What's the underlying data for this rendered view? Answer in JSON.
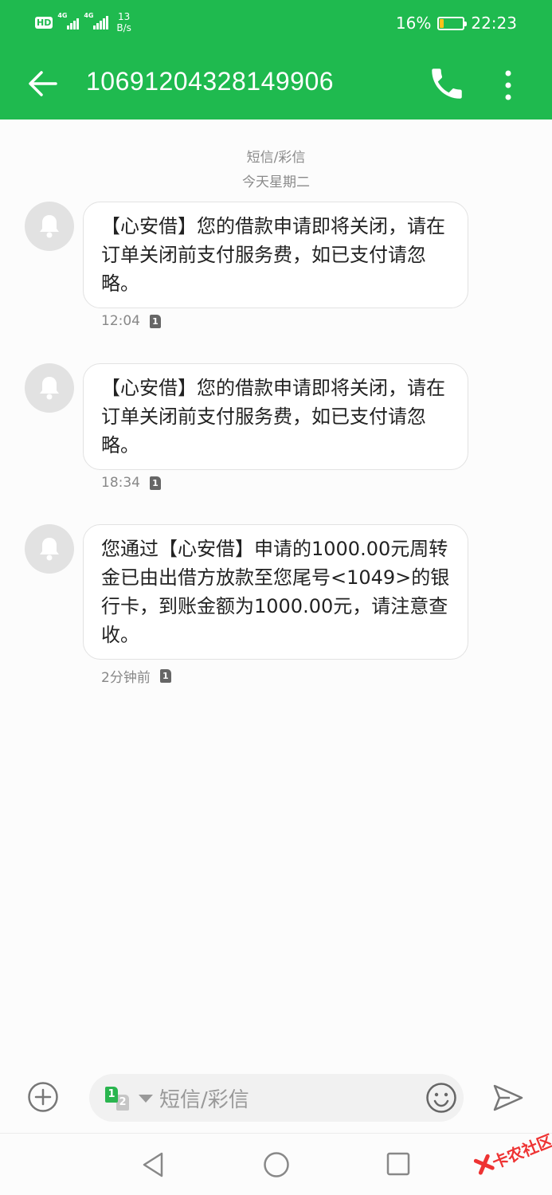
{
  "status_bar": {
    "hd_badge": "HD",
    "signal_1_label": "4G",
    "signal_2_label": "4G",
    "net_speed_value": "13",
    "net_speed_unit": "B/s",
    "battery_percent_text": "16%",
    "battery_level": 0.16,
    "time": "22:23"
  },
  "app_bar": {
    "title": "10691204328149906",
    "icons": [
      "back-arrow-icon",
      "phone-icon",
      "more-vert-icon"
    ]
  },
  "conversation": {
    "type_label": "短信/彩信",
    "date_label": "今天星期二",
    "messages": [
      {
        "text": "【心安借】您的借款申请即将关闭，请在订单关闭前支付服务费，如已支付请忽略。",
        "time": "12:04",
        "sim": "1"
      },
      {
        "text": "【心安借】您的借款申请即将关闭，请在订单关闭前支付服务费，如已支付请忽略。",
        "time": "18:34",
        "sim": "1"
      },
      {
        "text": "您通过【心安借】申请的1000.00元周转金已由出借方放款至您尾号<1049>的银行卡，到账金额为1000.00元，请注意查收。",
        "time": "2分钟前",
        "sim": "1"
      }
    ]
  },
  "compose": {
    "sim_primary": "1",
    "sim_secondary": "2",
    "placeholder": "短信/彩信"
  },
  "watermark": {
    "text": "卡农社区"
  },
  "colors": {
    "header_green": "#1fba4f",
    "battery_yellow": "#ffc21a",
    "sim_green": "#2ab54f"
  }
}
